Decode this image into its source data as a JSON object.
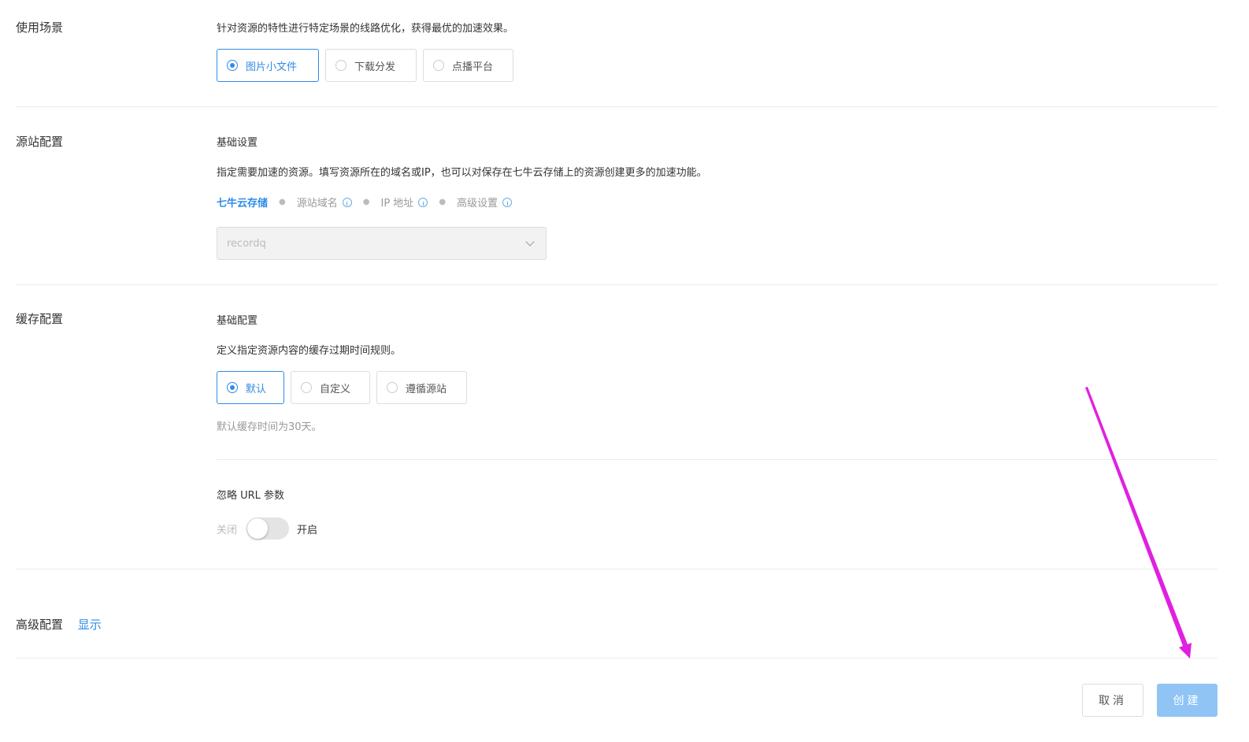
{
  "scene": {
    "title": "使用场景",
    "description": "针对资源的特性进行特定场景的线路优化，获得最优的加速效果。",
    "options": [
      "图片小文件",
      "下载分发",
      "点播平台"
    ],
    "selected_index": 0
  },
  "origin": {
    "title": "源站配置",
    "subtitle": "基础设置",
    "description": "指定需要加速的资源。填写资源所在的域名或IP，也可以对保存在七牛云存储上的资源创建更多的加速功能。",
    "tabs": [
      "七牛云存储",
      "源站域名",
      "IP 地址",
      "高级设置"
    ],
    "active_tab": 0,
    "select_value": "recordq"
  },
  "cache": {
    "title": "缓存配置",
    "subtitle": "基础配置",
    "description": "定义指定资源内容的缓存过期时间规则。",
    "options": [
      "默认",
      "自定义",
      "遵循源站"
    ],
    "selected_index": 0,
    "hint": "默认缓存时间为30天。",
    "ignore_url_title": "忽略 URL 参数",
    "toggle_off": "关闭",
    "toggle_on": "开启",
    "toggle_state": "off"
  },
  "advanced": {
    "title": "高级配置",
    "toggle_link": "显示"
  },
  "actions": {
    "cancel": "取消",
    "create": "创建"
  },
  "colors": {
    "accent": "#2f8ce8",
    "create_button": "#8fc4f5",
    "annotation": "#e020e0"
  }
}
